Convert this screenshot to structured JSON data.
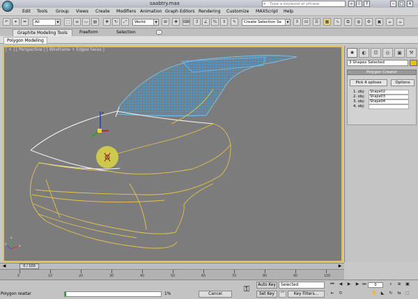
{
  "window": {
    "title": "saabtry.max",
    "help_search_placeholder": "Type a keyword or phrase",
    "controls": {
      "minimize": "–",
      "maximize": "□",
      "close": "×"
    }
  },
  "menu": [
    "Edit",
    "Tools",
    "Group",
    "Views",
    "Create",
    "Modifiers",
    "Animation",
    "Graph Editors",
    "Rendering",
    "Customize",
    "MAXScript",
    "Help"
  ],
  "toolbar": {
    "filter_value": "All",
    "coord_value": "World",
    "selection_set_value": "Create Selection Se",
    "icons": [
      "undo-icon",
      "redo-icon",
      "link-icon",
      "unlink-icon",
      "bind-icon"
    ]
  },
  "ribbon": {
    "tabs": [
      "Graphite Modeling Tools",
      "Freeform",
      "Selection"
    ],
    "active_tab": 0,
    "sub_tab": "Polygon Modeling"
  },
  "viewport": {
    "label": "[ + ] [ Perspective ] [ Wireframe + Edged Faces ]",
    "axis_labels": {
      "x": "x",
      "y": "y",
      "z": "z"
    }
  },
  "command_panel": {
    "tabs": [
      "create-icon",
      "modify-icon",
      "hierarchy-icon",
      "motion-icon",
      "display-icon",
      "utilities-icon"
    ],
    "tab_glyphs": [
      "✹",
      "◐",
      "☲",
      "◎",
      "▣",
      "⚒"
    ],
    "selection_text": "3 Shapes Selected",
    "object_color": "#e8c400",
    "rollout_title": "Polygon Creator",
    "rollout_toggle": "-",
    "pick_button": "Pick 4 splines",
    "options_button": "Options",
    "objects": [
      {
        "label": "1. obj:",
        "value": "Shape02"
      },
      {
        "label": "2. obj:",
        "value": "Shape03"
      },
      {
        "label": "3. obj:",
        "value": "Shape04"
      },
      {
        "label": "4. obj:",
        "value": ""
      }
    ]
  },
  "timeline": {
    "frame_display": "0 / 100",
    "ticks": [
      "0",
      "10",
      "20",
      "30",
      "40",
      "50",
      "60",
      "70",
      "80",
      "90",
      "100"
    ]
  },
  "status": {
    "message": "Polygon reaitar",
    "progress_percent": 1,
    "progress_label": "1%",
    "cancel_label": "Cancel",
    "auto_key_label": "Auto Key",
    "set_key_label": "Set Key",
    "selected_dropdown": "Selected",
    "key_filters_label": "Key Filters...",
    "frame_value": "0"
  }
}
